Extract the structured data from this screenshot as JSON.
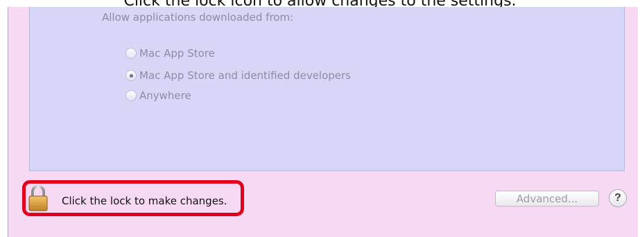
{
  "caption": "Click the lock icon to allow changes to the settings.",
  "gatekeeper": {
    "heading": "Allow applications downloaded from:",
    "options": [
      {
        "label": "Mac App Store",
        "selected": false
      },
      {
        "label": "Mac App Store and identified developers",
        "selected": true
      },
      {
        "label": "Anywhere",
        "selected": false
      }
    ]
  },
  "footer": {
    "lock_icon": "lock-icon",
    "lock_label": "Click the lock to make changes.",
    "advanced_label": "Advanced...",
    "help_label": "?"
  },
  "colors": {
    "window_bg": "#f7d9f3",
    "panel_bg": "#d8d6f6",
    "highlight": "#e4001c"
  }
}
